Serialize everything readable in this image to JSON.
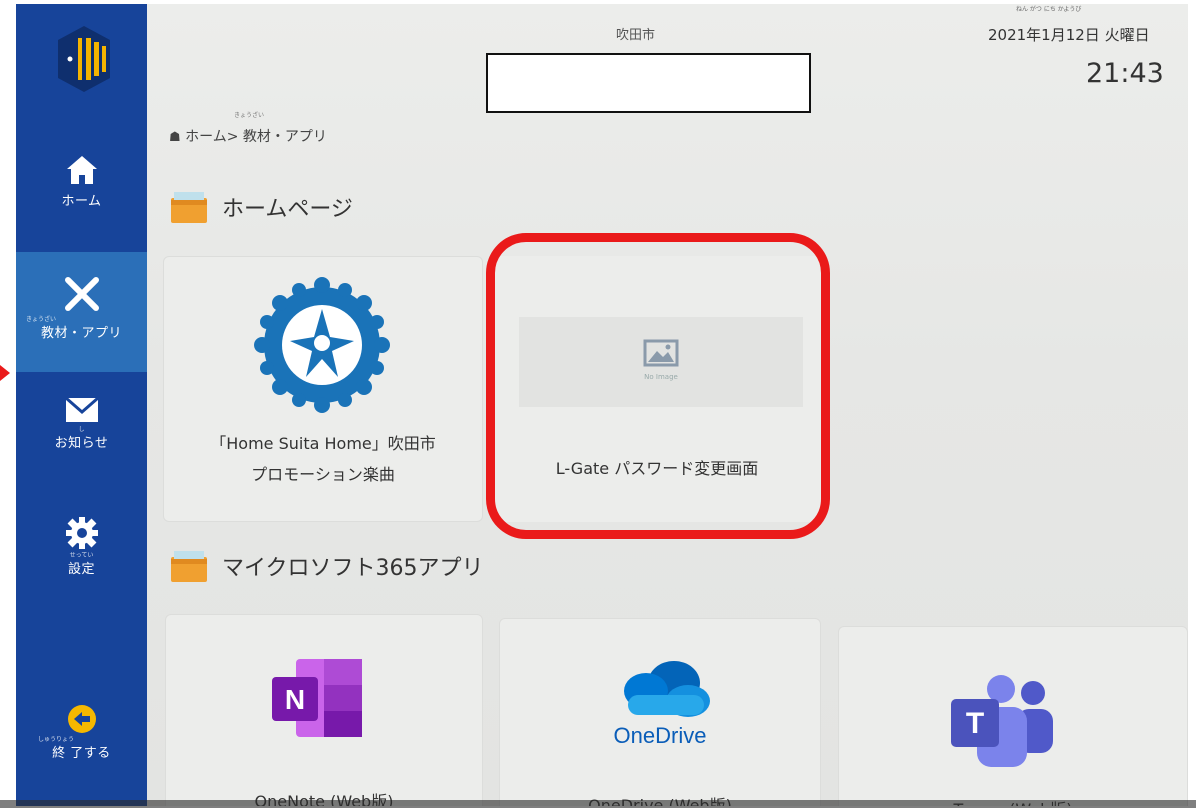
{
  "header": {
    "city": "吹田市",
    "date_ruby": "ねん がつ にち かようび",
    "date": "2021年1月12日 火曜日",
    "time": "21:43"
  },
  "breadcrumb": {
    "home_icon": "home-icon",
    "ruby": "きょうざい",
    "text": "ホーム> 教材・アプリ"
  },
  "sidebar": {
    "items": [
      {
        "icon": "home-icon",
        "ruby": "",
        "label": "ホーム"
      },
      {
        "icon": "tools-icon",
        "ruby": "きょうざい",
        "label": "教材・アプリ",
        "active": true
      },
      {
        "icon": "mail-icon",
        "ruby": "し",
        "label": "お知らせ"
      },
      {
        "icon": "gear-icon",
        "ruby": "せってい",
        "label": "設定"
      }
    ],
    "exit": {
      "icon": "arrow-left-circle-icon",
      "ruby": "しゅうりょう",
      "label": "終 了する"
    }
  },
  "sections": {
    "homepage": {
      "title": "ホームページ"
    },
    "microsoft": {
      "title": "マイクロソフト365アプリ"
    }
  },
  "cards": {
    "suita": {
      "line1": "「Home Suita Home」吹田市",
      "line2": "プロモーション楽曲"
    },
    "lgate": {
      "no_image": "No Image",
      "label": "L-Gate パスワード変更画面"
    },
    "onenote": {
      "label": "OneNote (Web版)"
    },
    "onedrive": {
      "logo_text": "OneDrive",
      "label": "OneDrive (Web版)"
    },
    "teams": {
      "label": "Teams (Web版)"
    }
  },
  "colors": {
    "sidebar": "#17449a",
    "sidebar_active": "#2b6fb8",
    "highlight": "#ea1a1a",
    "folder": "#f0a030"
  }
}
